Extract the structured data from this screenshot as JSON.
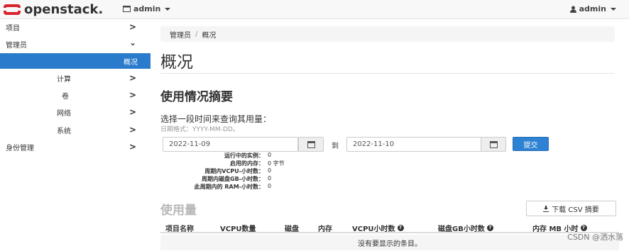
{
  "navbar": {
    "brand": "openstack.",
    "project_label": "admin",
    "user_label": "admin"
  },
  "sidebar": {
    "items": [
      {
        "label": "项目",
        "chevron": ">"
      },
      {
        "label": "管理员",
        "chevron": "⌄"
      },
      {
        "label": "概况",
        "active": true
      },
      {
        "label": "计算",
        "chevron": ">"
      },
      {
        "label": "卷",
        "chevron": ">"
      },
      {
        "label": "网络",
        "chevron": ">"
      },
      {
        "label": "系统",
        "chevron": ">"
      },
      {
        "label": "身份管理",
        "chevron": ">"
      }
    ]
  },
  "breadcrumb": {
    "first": "管理员",
    "separator": "/",
    "current": "概况"
  },
  "page_title": "概况",
  "summary": {
    "title": "使用情况摘要",
    "query_label": "选择一段时间来查询其用量：",
    "date_hint": "日期格式：YYYY-MM-DD。",
    "start_date": "2022-11-09",
    "to_label": "到",
    "end_date": "2022-11-10",
    "submit_label": "提交"
  },
  "stats": [
    {
      "label": "运行中的实例：",
      "value": "0"
    },
    {
      "label": "启用的内存：",
      "value": "0 字节"
    },
    {
      "label": "周期内VCPU-小时数：",
      "value": "0"
    },
    {
      "label": "周期内磁盘GB-小时数：",
      "value": "0"
    },
    {
      "label": "此周期内的 RAM-小时数：",
      "value": "0"
    }
  ],
  "usage": {
    "title": "使用量",
    "csv_button": "下载 CSV 摘要",
    "columns": [
      "项目名称",
      "VCPU数量",
      "磁盘",
      "内存",
      "VCPU小时数",
      "磁盘GB小时数",
      "内存 MB 小时"
    ],
    "empty_text": "没有要显示的条目。"
  },
  "watermark": "CSDN @洒水落",
  "colors": {
    "brand_red": "#d9232d",
    "active_blue": "#2a7bcc",
    "submit_blue": "#2d82d3"
  },
  "icons": [
    "openstack-logo",
    "project-icon",
    "user-icon",
    "calendar-icon",
    "download-icon",
    "help-icon"
  ]
}
